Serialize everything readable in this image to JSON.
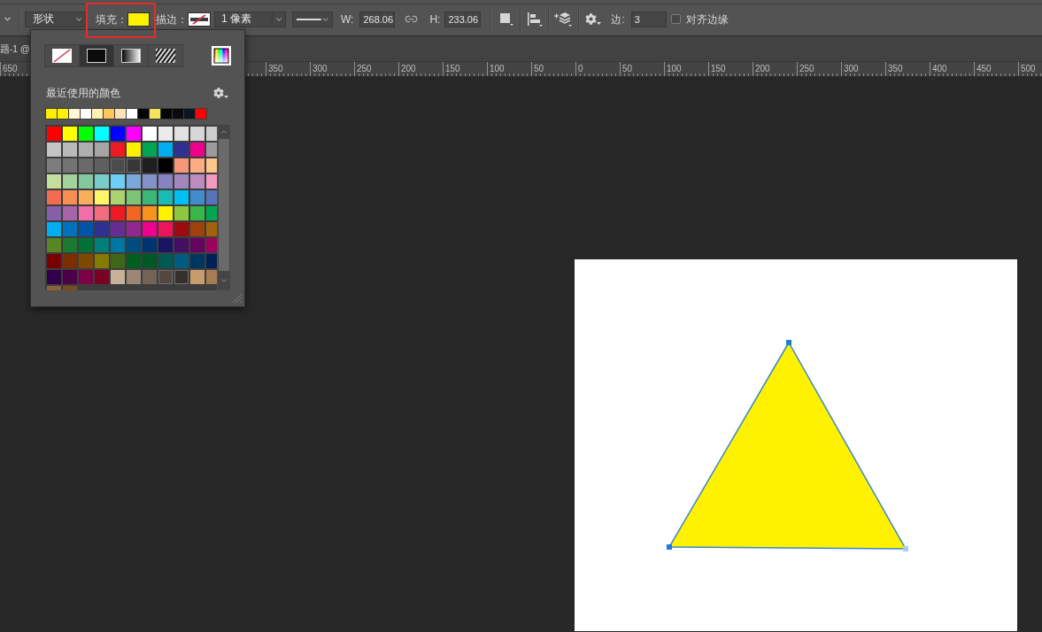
{
  "toolbar": {
    "shape_mode": {
      "value": "形状"
    },
    "fill": {
      "label": "填充：",
      "color": "#fff200",
      "highlighted": true
    },
    "stroke": {
      "label": "描边：",
      "width": "1 像素"
    },
    "width": {
      "label": "W:",
      "value": "268.06"
    },
    "height": {
      "label": "H:",
      "value": "233.06"
    },
    "sides": {
      "label": "边:",
      "value": "3"
    },
    "align_edges": {
      "label": "对齐边缘",
      "checked": false
    }
  },
  "document_tab": {
    "title": "题-1 @"
  },
  "ruler": {
    "labels": [
      "650",
      "350",
      "300",
      "250",
      "200",
      "150",
      "100",
      "50",
      "0",
      "50",
      "100",
      "150",
      "200",
      "250",
      "300",
      "350",
      "400",
      "450",
      "500"
    ]
  },
  "fill_panel": {
    "fill_types": [
      {
        "kind": "none",
        "selected": false
      },
      {
        "kind": "solid",
        "selected": true
      },
      {
        "kind": "gradient",
        "selected": false
      },
      {
        "kind": "pattern",
        "selected": false
      }
    ],
    "recent_title": "最近使用的颜色",
    "recent_colors": [
      {
        "color": "#ffee00"
      },
      {
        "color": "#fff200"
      },
      {
        "color": "#fff6d5"
      },
      {
        "color": "#ffffff"
      },
      {
        "color": "#fff1b0"
      },
      {
        "color": "#fdc75c"
      },
      {
        "color": "#fde3b8"
      },
      {
        "color": "#ffffff"
      },
      {
        "color": "#050505"
      },
      {
        "color": "#f7e35e"
      },
      {
        "color": "#050505"
      },
      {
        "color": "#0b0b0b"
      },
      {
        "color": "#0c1422"
      },
      {
        "color": "#ff0000"
      }
    ],
    "swatches": [
      {
        "color": "#ff0000"
      },
      {
        "color": "#ffff00"
      },
      {
        "color": "#00ff00"
      },
      {
        "color": "#00ffff"
      },
      {
        "color": "#0000ff"
      },
      {
        "color": "#ff00ff"
      },
      {
        "color": "#ffffff"
      },
      {
        "color": "#ebebeb"
      },
      {
        "color": "#e1e1e1"
      },
      {
        "color": "#d7d7d7"
      },
      {
        "color": "#cdcdcd"
      },
      {
        "color": "#c3c3c3"
      },
      {
        "color": "#b9b9b9"
      },
      {
        "color": "#afafaf"
      },
      {
        "color": "#a5a5a5"
      },
      {
        "color": "#ed1c24"
      },
      {
        "color": "#fff200"
      },
      {
        "color": "#00a651"
      },
      {
        "color": "#00aeef"
      },
      {
        "color": "#2e3192"
      },
      {
        "color": "#ec008c"
      },
      {
        "color": "#9b9b9b"
      },
      {
        "color": "#7d7d7d"
      },
      {
        "color": "#737373"
      },
      {
        "color": "#696969"
      },
      {
        "color": "#5f5f5f"
      },
      {
        "color": "#4b4b4b"
      },
      {
        "color": "#373737"
      },
      {
        "color": "#1e1e1e"
      },
      {
        "color": "#000000"
      },
      {
        "color": "#f7977a"
      },
      {
        "color": "#f9ad81"
      },
      {
        "color": "#fdc68a"
      },
      {
        "color": "#c4df9b"
      },
      {
        "color": "#a3d39c"
      },
      {
        "color": "#82ca9d"
      },
      {
        "color": "#7accc8"
      },
      {
        "color": "#6dcff6"
      },
      {
        "color": "#7da7d9"
      },
      {
        "color": "#8393ca"
      },
      {
        "color": "#8882be"
      },
      {
        "color": "#a187be"
      },
      {
        "color": "#bc8dbf"
      },
      {
        "color": "#f49ac2"
      },
      {
        "color": "#f26c4f"
      },
      {
        "color": "#f68e56"
      },
      {
        "color": "#fbaf5d"
      },
      {
        "color": "#fff568"
      },
      {
        "color": "#acd372"
      },
      {
        "color": "#7cc576"
      },
      {
        "color": "#3bb878"
      },
      {
        "color": "#1abbb4"
      },
      {
        "color": "#00bff3"
      },
      {
        "color": "#438ccb"
      },
      {
        "color": "#5574b9"
      },
      {
        "color": "#8560a8"
      },
      {
        "color": "#a864a8"
      },
      {
        "color": "#f06eaa"
      },
      {
        "color": "#f26d7d"
      },
      {
        "color": "#ed1c24"
      },
      {
        "color": "#f26522"
      },
      {
        "color": "#f7941d"
      },
      {
        "color": "#fff200"
      },
      {
        "color": "#8dc73f"
      },
      {
        "color": "#39b54a"
      },
      {
        "color": "#00a651"
      },
      {
        "color": "#00aeef"
      },
      {
        "color": "#0072bc"
      },
      {
        "color": "#0054a6"
      },
      {
        "color": "#2e3192"
      },
      {
        "color": "#662d91"
      },
      {
        "color": "#92278f"
      },
      {
        "color": "#ec008c"
      },
      {
        "color": "#ed145b"
      },
      {
        "color": "#9e0b0f"
      },
      {
        "color": "#a0410d"
      },
      {
        "color": "#a36209"
      },
      {
        "color": "#598527"
      },
      {
        "color": "#1a7b30"
      },
      {
        "color": "#007236"
      },
      {
        "color": "#007e79"
      },
      {
        "color": "#0076a3"
      },
      {
        "color": "#004b80"
      },
      {
        "color": "#003471"
      },
      {
        "color": "#1b1464"
      },
      {
        "color": "#440e62"
      },
      {
        "color": "#630460"
      },
      {
        "color": "#9e005d"
      },
      {
        "color": "#790000"
      },
      {
        "color": "#7b2e00"
      },
      {
        "color": "#7d4900"
      },
      {
        "color": "#827b00"
      },
      {
        "color": "#406618"
      },
      {
        "color": "#005e20"
      },
      {
        "color": "#005826"
      },
      {
        "color": "#005952"
      },
      {
        "color": "#005b7f"
      },
      {
        "color": "#003663"
      },
      {
        "color": "#002157"
      },
      {
        "color": "#32004b"
      },
      {
        "color": "#4b0049"
      },
      {
        "color": "#7b0046"
      },
      {
        "color": "#7a0026"
      },
      {
        "color": "#c7b299"
      },
      {
        "color": "#998675"
      },
      {
        "color": "#736357"
      },
      {
        "color": "#534741"
      },
      {
        "color": "#362f2d"
      },
      {
        "color": "#c69c6d"
      },
      {
        "color": "#a67c52"
      },
      {
        "color": "#8c6239"
      },
      {
        "color": "#754c24"
      }
    ]
  },
  "canvas": {
    "shape": {
      "kind": "triangle"
    }
  }
}
